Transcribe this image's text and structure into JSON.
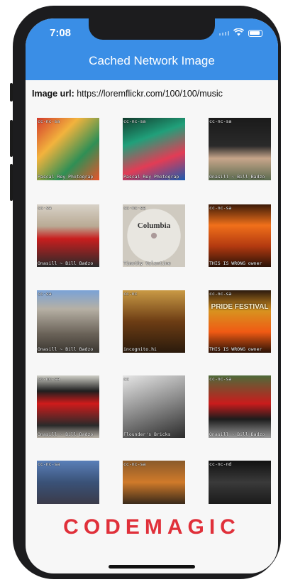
{
  "status": {
    "time": "7:08"
  },
  "appbar": {
    "title": "Cached Network Image"
  },
  "url": {
    "label": "Image url:",
    "value": "https://loremflickr.com/100/100/music"
  },
  "images": [
    {
      "license": "cc-nc-sa",
      "credit": "Pascal Rey Photograp",
      "bg": "linear-gradient(135deg,#d33b2c,#f2b33d,#2f8f55,#e8532b)"
    },
    {
      "license": "cc-nc-sa",
      "credit": "Pascal Rey Photograp",
      "bg": "linear-gradient(160deg,#123b2c,#20a07a,#e23c55,#1a5bb0)"
    },
    {
      "license": "cc-nc-sa",
      "credit": "Onasill ~ Bill Badzo",
      "bg": "linear-gradient(180deg,#1a1a1a 0%,#2a2a2a 45%,#c7a58a 65%,#5a6b4f 100%)"
    },
    {
      "license": "cc-sa",
      "credit": "Onasill ~ Bill Badzo",
      "bg": "linear-gradient(180deg,#d8d2c8 0%,#b9aa94 35%,#c81e1e 55%,#2a2a2a 100%)"
    },
    {
      "license": "cc-nc-sa",
      "credit": "Timothy Valentine",
      "bg": "radial-gradient(circle at 50% 50%,#a99 0 6%,#e8e6e0 7% 60%,#cfcac0 61%)",
      "disc_text": "Columbia"
    },
    {
      "license": "cc-nc-sa",
      "credit": "THIS IS WRONG owner",
      "bg": "linear-gradient(180deg,#3b1a08,#f0701a,#b43a10,#2a1206)"
    },
    {
      "license": "cc-sa",
      "credit": "Onasill ~ Bill Badzo",
      "bg": "linear-gradient(180deg,#7aa2d6 0%,#b6b0a4 30%,#6a6258 70%,#3a3630 100%)"
    },
    {
      "license": "cc-nc",
      "credit": "incognito.hi",
      "bg": "linear-gradient(180deg,#c99a45,#6d3d14,#2a1a0c)"
    },
    {
      "license": "cc-nc-sa",
      "credit": "THIS IS WRONG owner",
      "bg": "linear-gradient(180deg,#2b1a0e,#d8921f,#f05a14,#2a1206)",
      "poster_text": "PRIDE FESTIVAL"
    },
    {
      "license": "cc-nc-sa",
      "credit": "Onasill ~ Bill Badzo",
      "bg": "linear-gradient(180deg,#d0d0c8 0%,#1f1f1f 25%,#cf1b1b 45%,#2a2a2a 80%,#b9b3a9 100%)"
    },
    {
      "license": "cc",
      "credit": "Flounder's Bricks",
      "bg": "linear-gradient(160deg,#e6e6e6,#8a8a8a,#2b2b2b)"
    },
    {
      "license": "cc-nc-sa",
      "credit": "Onasill ~ Bill Badzo",
      "bg": "linear-gradient(180deg,#4e6b3a 0%,#c91c1c 45%,#1c1c1c 70%,#9a9a9a 100%)"
    },
    {
      "license": "cc-nc-sa",
      "credit": "",
      "bg": "linear-gradient(180deg,#5a7fb8,#3a5278,#3b3b4a)"
    },
    {
      "license": "cc-nc-sa",
      "credit": "",
      "bg": "linear-gradient(180deg,#8a5a2a,#d07a2a,#3a2a1a)"
    },
    {
      "license": "cc-nc-nd",
      "credit": "",
      "bg": "linear-gradient(180deg,#111,#3a3a3a,#1a1a1a)"
    }
  ],
  "brand": {
    "text": "CODEMAGIC",
    "color": "#e0303a"
  },
  "colors": {
    "appbar": "#3a8ee6",
    "screen_bg": "#f7f7f7"
  }
}
